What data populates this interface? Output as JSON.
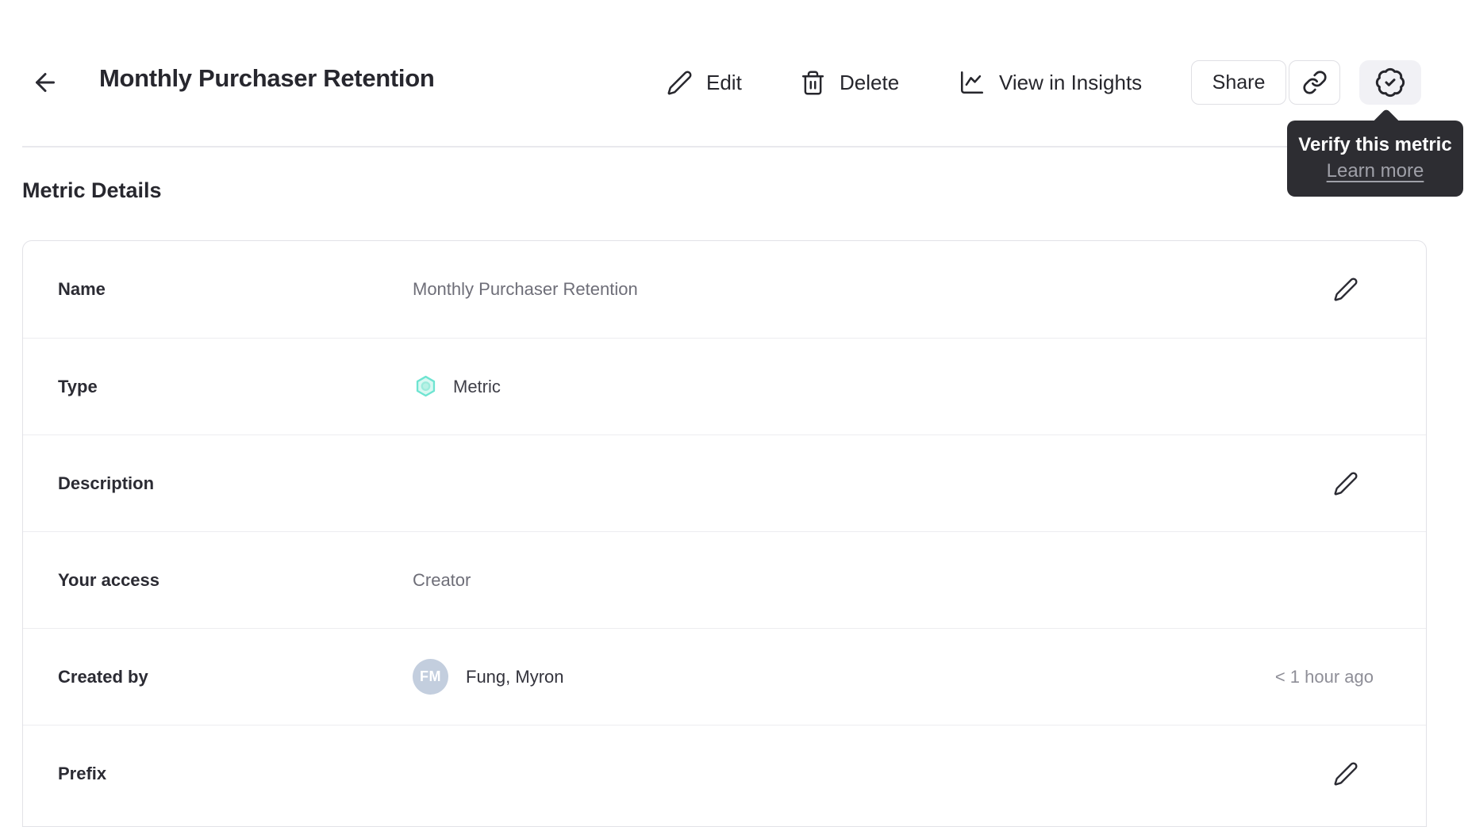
{
  "header": {
    "title": "Monthly Purchaser Retention",
    "actions": {
      "edit": "Edit",
      "delete": "Delete",
      "view_in_insights": "View in Insights",
      "share": "Share"
    }
  },
  "tooltip": {
    "title": "Verify this metric",
    "link": "Learn more"
  },
  "section": {
    "title": "Metric Details"
  },
  "details": {
    "rows": [
      {
        "label": "Name",
        "value": "Monthly Purchaser Retention"
      },
      {
        "label": "Type",
        "value": "Metric"
      },
      {
        "label": "Description",
        "value": ""
      },
      {
        "label": "Your access",
        "value": "Creator"
      },
      {
        "label": "Created by",
        "value": "Fung, Myron",
        "avatar_initials": "FM",
        "timestamp": "< 1 hour ago"
      },
      {
        "label": "Prefix",
        "value": ""
      }
    ]
  },
  "colors": {
    "accent_teal": "#6ee4d1",
    "teal_fill": "#d9f8f2",
    "teal_inner": "#9debdc",
    "tooltip_bg": "#2d2d32",
    "avatar_bg": "#c3cede",
    "text_dark": "#27272e",
    "text_gray": "#6e6e78"
  }
}
